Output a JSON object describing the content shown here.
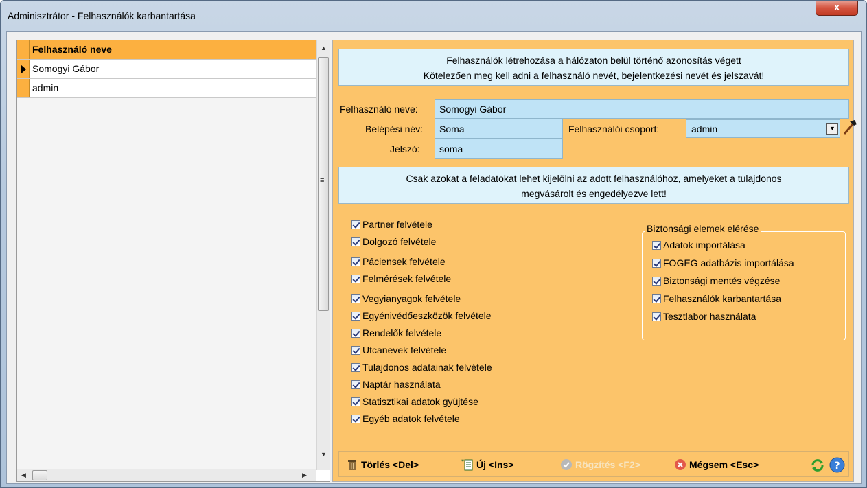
{
  "window": {
    "title": "Adminisztrátor - Felhasználók karbantartása",
    "close_glyph": "x"
  },
  "grid": {
    "header": "Felhasználó neve",
    "rows": [
      "Somogyi Gábor",
      "admin"
    ]
  },
  "info_top": {
    "line1": "Felhasználók létrehozása a hálózaton belül történő azonosítás végett",
    "line2": "Kötelezően meg kell adni a felhasználó nevét, bejelentkezési nevét és jelszavát!"
  },
  "form": {
    "name_label": "Felhasználó neve:",
    "name_value": "Somogyi Gábor",
    "login_label": "Belépési név:",
    "login_value": "Soma",
    "password_label": "Jelszó:",
    "password_value": "soma",
    "group_label": "Felhasználói csoport:",
    "group_value": "admin"
  },
  "info_mid": {
    "line1": "Csak azokat a feladatokat lehet kijelölni az adott felhasználóhoz, amelyeket a tulajdonos",
    "line2": "megvásárolt és engedélyezve lett!"
  },
  "tasks": [
    "Partner felvétele",
    "Dolgozó felvétele",
    "Páciensek felvétele",
    "Felmérések felvétele",
    "Vegyianyagok felvétele",
    "Egyénivédőeszközök felvétele",
    "Rendelők felvétele",
    "Utcanevek felvétele",
    "Tulajdonos adatainak felvétele",
    "Naptár használata",
    "Statisztikai adatok gyüjtése",
    "Egyéb adatok felvétele"
  ],
  "security": {
    "title": "Biztonsági elemek elérése",
    "items": [
      "Adatok importálása",
      "FOGEG adatbázis importálása",
      "Biztonsági mentés végzése",
      "Felhasználók karbantartása",
      "Tesztlabor használata"
    ]
  },
  "toolbar": {
    "delete": "Törlés <Del>",
    "new": "Új <Ins>",
    "save": "Rögzítés <F2>",
    "cancel": "Mégsem <Esc>"
  },
  "colors": {
    "panel": "#fcc46a",
    "field": "#bfe3f6",
    "info": "#dff3fb",
    "indicator": "#fcb040"
  }
}
